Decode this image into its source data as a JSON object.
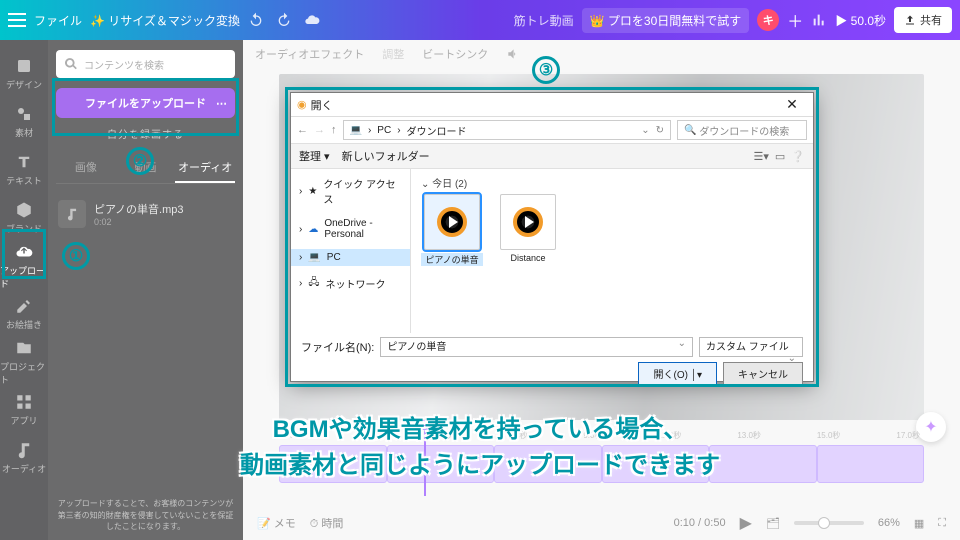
{
  "topbar": {
    "file": "ファイル",
    "resize": "リサイズ＆マジック変換",
    "title": "筋トレ動画",
    "trial": "プロを30日間無料で試す",
    "avatar": "キ",
    "duration": "50.0秒",
    "share": "共有"
  },
  "rail": {
    "items": [
      "デザイン",
      "素材",
      "テキスト",
      "ブランド",
      "アップロード",
      "お絵描き",
      "プロジェクト",
      "アプリ",
      "オーディオ"
    ],
    "active_index": 4
  },
  "panel": {
    "search_placeholder": "コンテンツを検索",
    "upload": "ファイルをアップロード",
    "record": "自分を録画する",
    "tabs": [
      "画像",
      "動画",
      "オーディオ"
    ],
    "active_tab": 2,
    "asset_name": "ピアノの単音.mp3",
    "asset_time": "0:02",
    "consent": "アップロードすることで、お客様のコンテンツが第三者の知的財産権を侵害していないことを保証したことになります。"
  },
  "effects": {
    "audio_effect": "オーディオエフェクト",
    "adjust": "調整",
    "beatsync": "ビートシンク"
  },
  "win": {
    "title": "開く",
    "path_pc": "PC",
    "path_dl": "ダウンロード",
    "search_ph": "ダウンロードの検索",
    "organize": "整理",
    "newfolder": "新しいフォルダー",
    "side": {
      "quick": "クイック アクセス",
      "onedrive": "OneDrive - Personal",
      "pc": "PC",
      "network": "ネットワーク"
    },
    "group": "今日 (2)",
    "files": [
      {
        "name": "ピアノの単音"
      },
      {
        "name": "Distance"
      }
    ],
    "filename_label": "ファイル名(N):",
    "filename_value": "ピアノの単音",
    "filetype": "カスタム ファイル",
    "open": "開く(O)",
    "cancel": "キャンセル"
  },
  "timeline": {
    "marks": [
      "0.0秒",
      "3.0秒",
      "5.0秒",
      "7.0秒",
      "9.0秒",
      "11.0秒",
      "13.0秒",
      "15.0秒",
      "17.0秒"
    ],
    "memo": "メモ",
    "duration_btn": "時間",
    "time": "0:10 / 0:50",
    "zoom": "66%"
  },
  "anno": {
    "n1": "①",
    "n2": "②",
    "n3": "③",
    "subtitle_l1": "BGMや効果音素材を持っている場合、",
    "subtitle_l2": "動画素材と同じようにアップロードできます"
  }
}
